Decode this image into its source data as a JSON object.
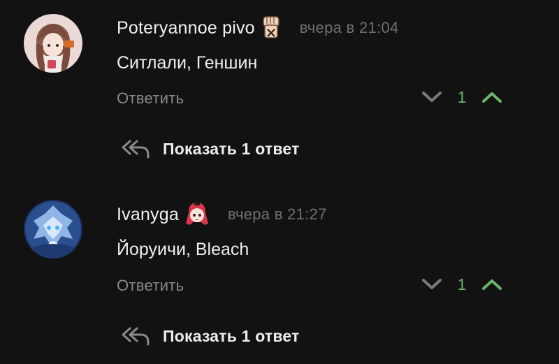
{
  "comments": [
    {
      "author": "Poteryannoe pivo",
      "time": "вчера в 21:04",
      "text": "Ситлали, Геншин",
      "reply_label": "Ответить",
      "votes": "1",
      "show_replies_label": "Показать 1 ответ",
      "avatar_icon": "anime-girl-avatar",
      "badge_icon": "raised-fist-emoji"
    },
    {
      "author": "Ivanyga",
      "time": "вчера в 21:27",
      "text": "Йоруичи, Bleach",
      "reply_label": "Ответить",
      "votes": "1",
      "show_replies_label": "Показать 1 ответ",
      "avatar_icon": "blue-dragon-avatar",
      "badge_icon": "red-hair-girl-emoji"
    }
  ],
  "colors": {
    "background": "#121212",
    "vote_count": "#6cb26c",
    "upvote_arrow": "#6cb26c",
    "downvote_arrow": "#7a7a7a",
    "secondary_text": "#8a8a8a"
  }
}
